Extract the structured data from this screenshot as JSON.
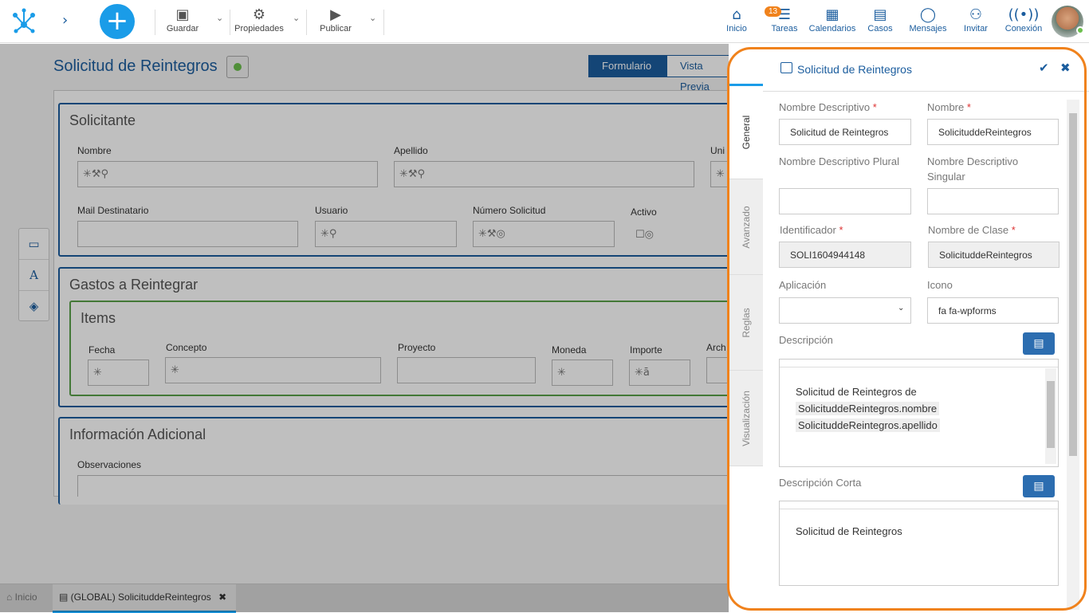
{
  "toolbar": {
    "save": "Guardar",
    "properties": "Propiedades",
    "publish": "Publicar",
    "add": "+",
    "expand": "›"
  },
  "nav": {
    "home": "Inicio",
    "tasks": "Tareas",
    "tasks_badge": "13",
    "calendars": "Calendarios",
    "cases": "Casos",
    "messages": "Mensajes",
    "invite": "Invitar",
    "connection": "Conexión"
  },
  "page": {
    "title": "Solicitud de Reintegros",
    "view_tabs": [
      "Formulario",
      "Vista Previa"
    ]
  },
  "form": {
    "sections": {
      "solicitante": "Solicitante",
      "gastos": "Gastos a Reintegrar",
      "items": "Items",
      "adicional": "Información Adicional"
    },
    "fields": {
      "nombre": "Nombre",
      "apellido": "Apellido",
      "unidad": "Uni",
      "mail": "Mail Destinatario",
      "usuario": "Usuario",
      "numero": "Número Solicitud",
      "activo": "Activo",
      "fecha": "Fecha",
      "concepto": "Concepto",
      "proyecto": "Proyecto",
      "moneda": "Moneda",
      "importe": "Importe",
      "archivo": "Arch",
      "observaciones": "Observaciones"
    }
  },
  "tools": {
    "laptop": "▭",
    "text": "A",
    "cube": "◈"
  },
  "bottom": {
    "home": "Inicio",
    "doc": "(GLOBAL) SolicituddeReintegros",
    "close": "✖"
  },
  "panel": {
    "title": "Solicitud de Reintegros",
    "ok": "✔",
    "close": "✖",
    "tabs": [
      "General",
      "Avanzado",
      "Reglas",
      "Visualización"
    ],
    "labels": {
      "nombre_descriptivo": "Nombre Descriptivo",
      "nombre": "Nombre",
      "plural": "Nombre Descriptivo Plural",
      "singular": "Nombre Descriptivo Singular",
      "identificador": "Identificador",
      "clase": "Nombre de Clase",
      "aplicacion": "Aplicación",
      "icono": "Icono",
      "descripcion": "Descripción",
      "descripcion_corta": "Descripción Corta"
    },
    "values": {
      "nombre_descriptivo": "Solicitud de Reintegros",
      "nombre": "SolicituddeReintegros",
      "plural": "",
      "singular": "",
      "identificador": "SOLI1604944148",
      "clase": "SolicituddeReintegros",
      "aplicacion": "",
      "icono": "fa fa-wpforms"
    },
    "descripcion": {
      "line1": "Solicitud de Reintegros de",
      "token1": "SolicituddeReintegros.nombre",
      "token2": "SolicituddeReintegros.apellido"
    },
    "descripcion_corta": "Solicitud de Reintegros"
  }
}
